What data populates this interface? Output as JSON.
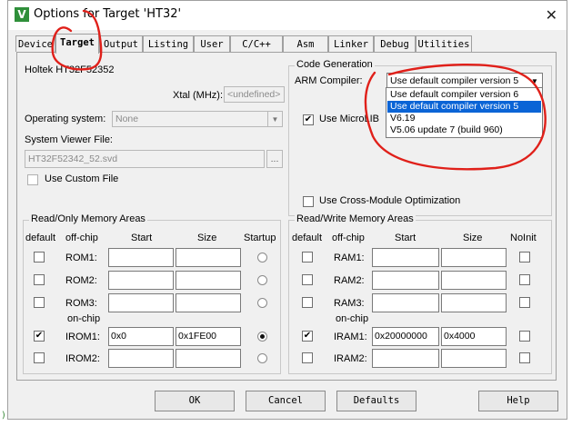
{
  "window": {
    "title": "Options for Target 'HT32'",
    "icon": "V",
    "close_symbol": "✕"
  },
  "tabs": [
    {
      "label": "Device",
      "active": false
    },
    {
      "label": "Target",
      "active": true
    },
    {
      "label": "Output",
      "active": false
    },
    {
      "label": "Listing",
      "active": false
    },
    {
      "label": "User",
      "active": false
    },
    {
      "label": "C/C++",
      "active": false
    },
    {
      "label": "Asm",
      "active": false
    },
    {
      "label": "Linker",
      "active": false
    },
    {
      "label": "Debug",
      "active": false
    },
    {
      "label": "Utilities",
      "active": false
    }
  ],
  "target": {
    "device_name": "Holtek HT32F52352",
    "xtal_label": "Xtal (MHz):",
    "xtal_value": "<undefined>",
    "os_label": "Operating system:",
    "os_value": "None",
    "svd_label": "System Viewer File:",
    "svd_value": "HT32F52342_52.svd",
    "browse_label": "...",
    "custom_file_label": "Use Custom File"
  },
  "code_generation": {
    "title": "Code Generation",
    "compiler_label": "ARM Compiler:",
    "compiler_value": "Use default compiler version 5",
    "options": [
      "Use default compiler version 6",
      "Use default compiler version 5",
      "V6.19",
      "V5.06 update 7 (build 960)"
    ],
    "selected_index": 1,
    "microlib_label": "Use MicroLIB",
    "microlib_checked": true,
    "cross_module_label": "Use Cross-Module Optimization",
    "cross_module_checked": false
  },
  "ro_memory": {
    "title": "Read/Only Memory Areas",
    "headers": {
      "default": "default",
      "offchip": "off-chip",
      "start": "Start",
      "size": "Size",
      "startup": "Startup"
    },
    "onchip_label": "on-chip",
    "rows": [
      {
        "name": "ROM1:",
        "start": "",
        "size": "",
        "default": false,
        "startup": false
      },
      {
        "name": "ROM2:",
        "start": "",
        "size": "",
        "default": false,
        "startup": false
      },
      {
        "name": "ROM3:",
        "start": "",
        "size": "",
        "default": false,
        "startup": false
      },
      {
        "name": "IROM1:",
        "start": "0x0",
        "size": "0x1FE00",
        "default": true,
        "startup": true
      },
      {
        "name": "IROM2:",
        "start": "",
        "size": "",
        "default": false,
        "startup": false
      }
    ]
  },
  "rw_memory": {
    "title": "Read/Write Memory Areas",
    "headers": {
      "default": "default",
      "offchip": "off-chip",
      "start": "Start",
      "size": "Size",
      "noinit": "NoInit"
    },
    "onchip_label": "on-chip",
    "rows": [
      {
        "name": "RAM1:",
        "start": "",
        "size": "",
        "default": false,
        "noinit": false
      },
      {
        "name": "RAM2:",
        "start": "",
        "size": "",
        "default": false,
        "noinit": false
      },
      {
        "name": "RAM3:",
        "start": "",
        "size": "",
        "default": false,
        "noinit": false
      },
      {
        "name": "IRAM1:",
        "start": "0x20000000",
        "size": "0x4000",
        "default": true,
        "noinit": false
      },
      {
        "name": "IRAM2:",
        "start": "",
        "size": "",
        "default": false,
        "noinit": false
      }
    ]
  },
  "buttons": {
    "ok": "OK",
    "cancel": "Cancel",
    "defaults": "Defaults",
    "help": "Help"
  },
  "colors": {
    "selection": "#0a64d6",
    "annotation": "#e0201a"
  }
}
